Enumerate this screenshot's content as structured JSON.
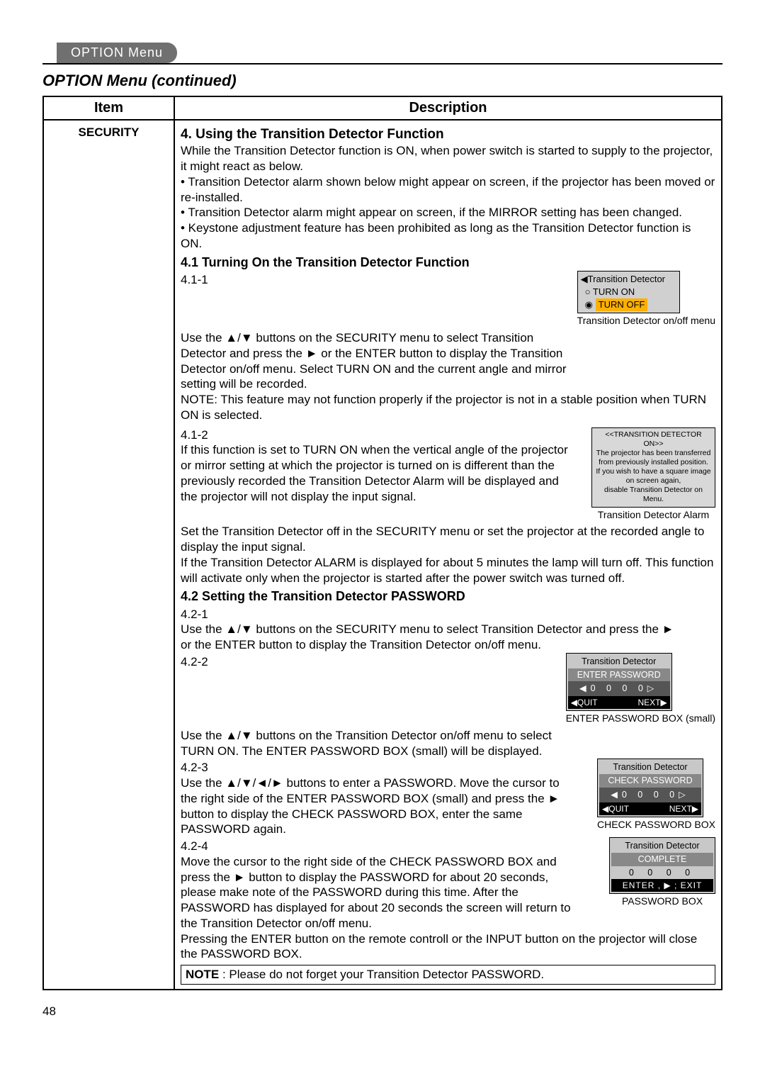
{
  "header": {
    "menu_tab": "OPTION Menu",
    "page_title": "OPTION Menu (continued)"
  },
  "table": {
    "col1": "Item",
    "col2": "Description",
    "item": "SECURITY"
  },
  "s4": {
    "heading": "4. Using the Transition Detector Function",
    "intro": "While the Transition Detector function is ON, when power switch is started to supply to the projector, it might react as below.",
    "b1": "• Transition Detector alarm shown below might appear on screen, if the projector has been moved or re-installed.",
    "b2": "• Transition Detector alarm might appear on screen, if the MIRROR setting has been changed.",
    "b3": "• Keystone adjustment feature has been prohibited as long as the Transition Detector function is ON."
  },
  "s41": {
    "heading": "4.1 Turning On the Transition Detector Function",
    "p1_num": "4.1-1",
    "p1": "Use the ▲/▼ buttons on the SECURITY menu to select Transition Detector and press the ► or the ENTER button to display the Transition Detector on/off menu. Select TURN ON and the current angle and mirror setting will be recorded.",
    "note": "NOTE: This feature may not function properly if the projector is not in a stable position when TURN ON is selected.",
    "p2_num": "4.1-2",
    "p2": "If this function is set to TURN ON when the vertical angle of the projector or mirror setting at which the projector is turned on is different than the previously recorded the Transition Detector Alarm will be displayed and the projector will not display the input signal.",
    "after": "Set the Transition Detector off in the SECURITY menu or set the projector at the recorded angle to display the input signal.",
    "after2": "If the Transition Detector ALARM is displayed for about 5 minutes the lamp will turn off. This function will activate only when the projector is started after the power switch was turned off."
  },
  "s42": {
    "heading": "4.2 Setting the Transition Detector PASSWORD",
    "p1_num": "4.2-1",
    "p1": "Use the ▲/▼ buttons on the SECURITY menu to select Transition Detector and press the ► or the ENTER button to display the Transition Detector on/off menu.",
    "p2_num": "4.2-2",
    "p2": "Use the ▲/▼ buttons on the Transition Detector on/off menu to select TURN ON. The ENTER PASSWORD BOX (small) will be displayed.",
    "p3_num": "4.2-3",
    "p3": "Use the ▲/▼/◄/► buttons to enter a PASSWORD. Move the cursor to the right side of the ENTER PASSWORD BOX (small) and press the ► button to display the CHECK PASSWORD BOX, enter the same PASSWORD again.",
    "p4_num": "4.2-4",
    "p4": "Move the cursor to the right side of the CHECK PASSWORD BOX and press the ► button to display the PASSWORD for about 20 seconds, please make note of the PASSWORD during this time. After the PASSWORD has displayed for about 20 seconds the screen will return to the Transition Detector on/off menu.",
    "after": "Pressing the ENTER button on the remote controll or the INPUT button on the projector will close the PASSWORD BOX.",
    "notebox_label": "NOTE",
    "notebox_text": " : Please do not forget your Transition Detector PASSWORD."
  },
  "osd": {
    "onoff_title": "◀Transition Detector",
    "turn_on": "TURN ON",
    "turn_off": "TURN OFF",
    "onoff_caption": "Transition Detector on/off menu",
    "alarm_title": "<<TRANSITION DETECTOR ON>>",
    "alarm_l1": "The projector has been transferred from previously installed position.",
    "alarm_l2": "If you wish to have a square image on screen again,",
    "alarm_l3": "disable Transition Detector on Menu.",
    "alarm_caption": "Transition Detector Alarm",
    "enter_title": "Transition Detector",
    "enter_sub": "ENTER PASSWORD",
    "digits": "0  0  0  0",
    "quit": "◀QUIT",
    "next": "NEXT▶",
    "enter_caption": "ENTER PASSWORD BOX (small)",
    "check_sub": "CHECK PASSWORD",
    "check_caption": "CHECK PASSWORD BOX",
    "complete": "COMPLETE",
    "enter_exit": "ENTER , ▶ ; EXIT",
    "pw_caption": "PASSWORD BOX"
  },
  "page_number": "48"
}
